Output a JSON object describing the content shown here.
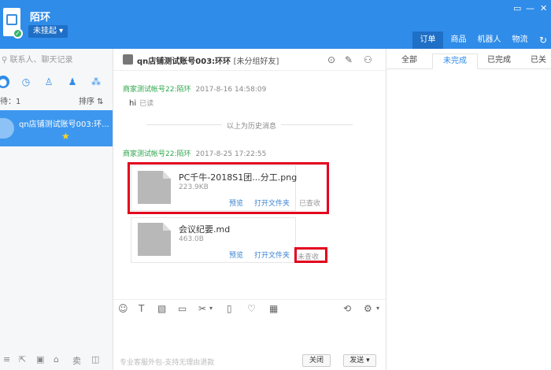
{
  "header": {
    "user_name": "陌环",
    "status": "未挂起 ▾",
    "window_controls": [
      "▭",
      "—",
      "✕"
    ],
    "tabs": [
      {
        "label": "订单",
        "active": true
      },
      {
        "label": "商品",
        "active": false
      },
      {
        "label": "机器人",
        "active": false
      },
      {
        "label": "物流",
        "active": false
      }
    ],
    "refresh_icon": "↻"
  },
  "left": {
    "search_placeholder": "联系人、聊天记录",
    "waiting": "待：1",
    "sort": "排序 ⇅",
    "conversation": {
      "name": "qn店铺测试账号003:环...",
      "star": "★"
    }
  },
  "chat": {
    "title": "qn店铺测试账号003:环环",
    "title_tag": "[未分组好友]",
    "messages": [
      {
        "sender": "商家测试帐号22:陌环",
        "time": "2017-8-16 14:58:09",
        "text": "hi",
        "read": "已读"
      }
    ],
    "history_divider": "以上为历史消息",
    "message2": {
      "sender": "商家测试帐号22:陌环",
      "time": "2017-8-25 17:22:55"
    },
    "files": [
      {
        "name": "PC千牛-2018S1团...分工.png",
        "size": "223.9KB",
        "preview": "预览",
        "open_folder": "打开文件夹",
        "state": "已查收"
      },
      {
        "name": "会议纪要.md",
        "size": "463.0B",
        "preview": "预览",
        "open_folder": "打开文件夹",
        "state": "未查收"
      }
    ],
    "footer_hint": "专业客服外包-支持无理由退款",
    "close_label": "关闭",
    "send_label": "发送 ▾"
  },
  "right": {
    "sub_tabs": [
      {
        "label": "全部",
        "active": false
      },
      {
        "label": "未完成",
        "active": true
      },
      {
        "label": "已完成",
        "active": false
      },
      {
        "label": "已关",
        "active": false
      }
    ]
  },
  "colors": {
    "accent": "#2f8ce9",
    "highlight": "#e3001e",
    "sender": "#2ca74a"
  }
}
